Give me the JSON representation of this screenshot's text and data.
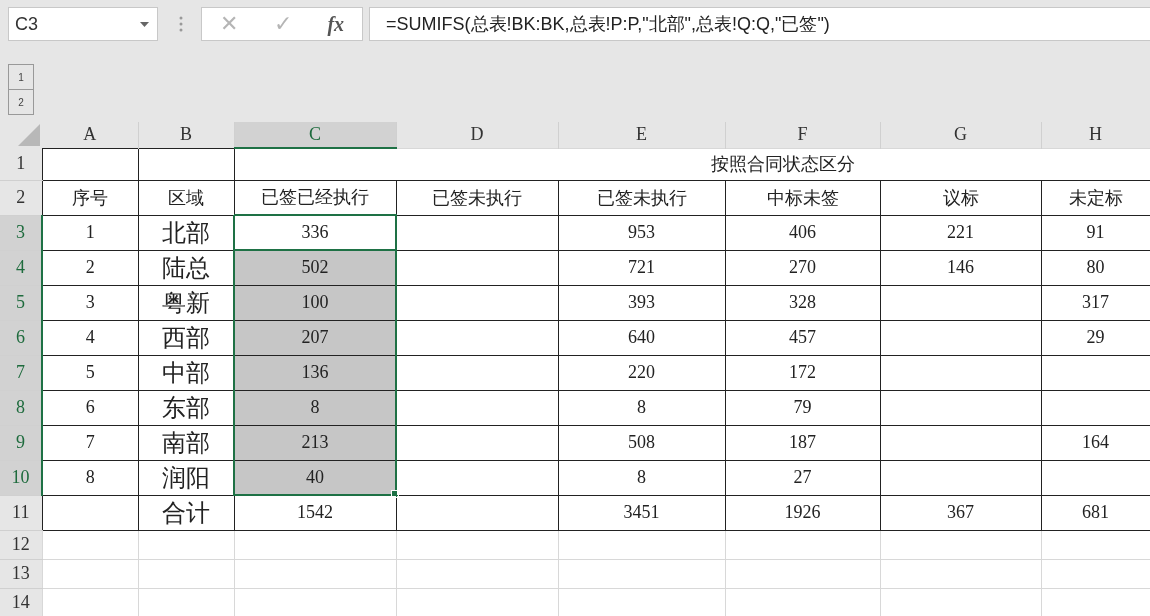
{
  "name_box": "C3",
  "formula_bar": {
    "cancel": "✕",
    "enter": "✓",
    "function": "fx",
    "formula": "=SUMIFS(总表!BK:BK,总表!P:P,\"北部\",总表!Q:Q,\"已签\")"
  },
  "outline_levels": [
    "1",
    "2"
  ],
  "columns": [
    {
      "label": "A",
      "selected": false
    },
    {
      "label": "B",
      "selected": false
    },
    {
      "label": "C",
      "selected": true
    },
    {
      "label": "D",
      "selected": false
    },
    {
      "label": "E",
      "selected": false
    },
    {
      "label": "F",
      "selected": false
    },
    {
      "label": "G",
      "selected": false
    },
    {
      "label": "H",
      "selected": false
    }
  ],
  "rows": [
    {
      "header": "1",
      "kind": "title",
      "selected": false,
      "active": false,
      "title": "按照合同状态区分"
    },
    {
      "header": "2",
      "kind": "data",
      "selected": false,
      "active": false,
      "cells": [
        "序号",
        "区域",
        "已签已经执行",
        "已签未执行",
        "已签未执行",
        "中标未签",
        "议标",
        "未定标"
      ]
    },
    {
      "header": "3",
      "kind": "data",
      "selected": true,
      "active": true,
      "cells": [
        "1",
        "北部",
        "336",
        null,
        "953",
        "406",
        "221",
        "91"
      ]
    },
    {
      "header": "4",
      "kind": "data",
      "selected": true,
      "active": false,
      "cells": [
        "2",
        "陆总",
        "502",
        null,
        "721",
        "270",
        "146",
        "80"
      ]
    },
    {
      "header": "5",
      "kind": "data",
      "selected": true,
      "active": false,
      "cells": [
        "3",
        "粤新",
        "100",
        null,
        "393",
        "328",
        null,
        "317"
      ]
    },
    {
      "header": "6",
      "kind": "data",
      "selected": true,
      "active": false,
      "cells": [
        "4",
        "西部",
        "207",
        null,
        "640",
        "457",
        null,
        "29"
      ]
    },
    {
      "header": "7",
      "kind": "data",
      "selected": true,
      "active": false,
      "cells": [
        "5",
        "中部",
        "136",
        null,
        "220",
        "172",
        null,
        null
      ]
    },
    {
      "header": "8",
      "kind": "data",
      "selected": true,
      "active": false,
      "cells": [
        "6",
        "东部",
        "8",
        null,
        "8",
        "79",
        null,
        null
      ]
    },
    {
      "header": "9",
      "kind": "data",
      "selected": true,
      "active": false,
      "cells": [
        "7",
        "南部",
        "213",
        null,
        "508",
        "187",
        null,
        "164"
      ]
    },
    {
      "header": "10",
      "kind": "data",
      "selected": true,
      "active": false,
      "cells": [
        "8",
        "润阳",
        "40",
        null,
        "8",
        "27",
        null,
        null
      ]
    },
    {
      "header": "11",
      "kind": "data",
      "selected": false,
      "active": false,
      "cells": [
        null,
        "合计",
        "1542",
        null,
        "3451",
        "1926",
        "367",
        "681"
      ]
    },
    {
      "header": "12",
      "kind": "empty",
      "selected": false,
      "active": false
    },
    {
      "header": "13",
      "kind": "empty",
      "selected": false,
      "active": false
    },
    {
      "header": "14",
      "kind": "empty",
      "selected": false,
      "active": false
    }
  ]
}
